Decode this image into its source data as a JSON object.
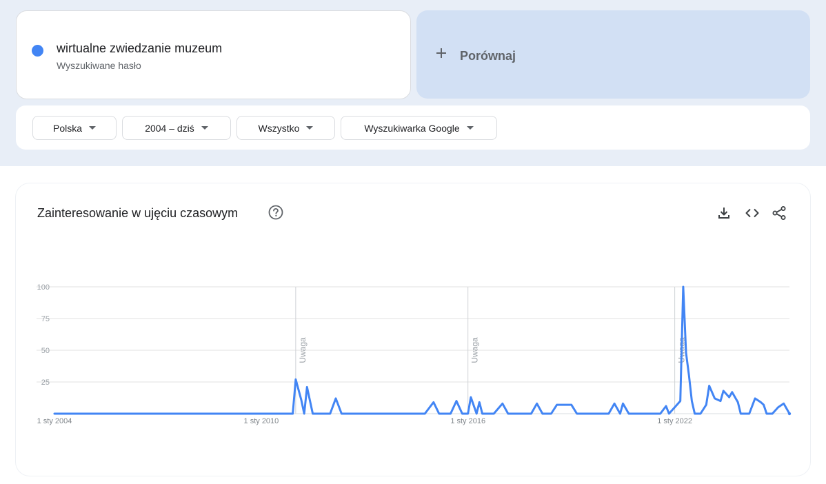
{
  "search_term": {
    "title": "wirtualne zwiedzanie muzeum",
    "subtitle": "Wyszukiwane hasło",
    "color": "#4285f4"
  },
  "compare": {
    "label": "Porównaj",
    "icon": "plus-icon"
  },
  "filters": {
    "region": "Polska",
    "period": "2004 – dziś",
    "category": "Wszystko",
    "source": "Wyszukiwarka Google"
  },
  "panel": {
    "title": "Zainteresowanie w ujęciu czasowym",
    "icons": [
      "help-icon",
      "download-icon",
      "embed-icon",
      "share-icon"
    ]
  },
  "chart_data": {
    "type": "line",
    "ylim": [
      0,
      100
    ],
    "y_ticks": [
      "100",
      "75",
      "50",
      "25"
    ],
    "x_range": [
      "2004-01-01",
      "2025-05-01"
    ],
    "x_ticks": [
      {
        "date": "2004-01-01",
        "label": "1 sty 2004"
      },
      {
        "date": "2010-01-01",
        "label": "1 sty 2010"
      },
      {
        "date": "2016-01-01",
        "label": "1 sty 2016"
      },
      {
        "date": "2022-01-01",
        "label": "1 sty 2022"
      }
    ],
    "notes": [
      {
        "date": "2011-01-01",
        "label": "Uwaga"
      },
      {
        "date": "2016-01-01",
        "label": "Uwaga"
      },
      {
        "date": "2022-01-01",
        "label": "Uwaga"
      }
    ],
    "series": [
      {
        "color": "#4285f4",
        "points": [
          [
            "2004-01-01",
            0
          ],
          [
            "2010-12-01",
            0
          ],
          [
            "2011-01-01",
            27
          ],
          [
            "2011-03-01",
            11
          ],
          [
            "2011-04-01",
            0
          ],
          [
            "2011-05-01",
            21
          ],
          [
            "2011-07-01",
            0
          ],
          [
            "2012-01-01",
            0
          ],
          [
            "2012-03-01",
            12
          ],
          [
            "2012-05-01",
            0
          ],
          [
            "2014-10-01",
            0
          ],
          [
            "2015-01-01",
            9
          ],
          [
            "2015-03-01",
            0
          ],
          [
            "2015-07-01",
            0
          ],
          [
            "2015-09-01",
            10
          ],
          [
            "2015-11-01",
            0
          ],
          [
            "2016-01-01",
            0
          ],
          [
            "2016-02-01",
            13
          ],
          [
            "2016-04-01",
            0
          ],
          [
            "2016-05-01",
            9
          ],
          [
            "2016-06-01",
            0
          ],
          [
            "2016-10-01",
            0
          ],
          [
            "2017-01-01",
            8
          ],
          [
            "2017-03-01",
            0
          ],
          [
            "2017-11-01",
            0
          ],
          [
            "2018-01-01",
            8
          ],
          [
            "2018-03-01",
            0
          ],
          [
            "2018-06-01",
            0
          ],
          [
            "2018-08-01",
            7
          ],
          [
            "2019-01-01",
            7
          ],
          [
            "2019-03-01",
            0
          ],
          [
            "2020-02-01",
            0
          ],
          [
            "2020-04-01",
            8
          ],
          [
            "2020-06-01",
            0
          ],
          [
            "2020-07-01",
            8
          ],
          [
            "2020-09-01",
            0
          ],
          [
            "2021-08-01",
            0
          ],
          [
            "2021-10-01",
            6
          ],
          [
            "2021-11-01",
            0
          ],
          [
            "2022-01-01",
            5
          ],
          [
            "2022-03-01",
            10
          ],
          [
            "2022-04-01",
            100
          ],
          [
            "2022-05-01",
            48
          ],
          [
            "2022-06-01",
            30
          ],
          [
            "2022-07-01",
            10
          ],
          [
            "2022-08-01",
            0
          ],
          [
            "2022-10-01",
            0
          ],
          [
            "2022-12-01",
            7
          ],
          [
            "2023-01-01",
            22
          ],
          [
            "2023-03-01",
            12
          ],
          [
            "2023-05-01",
            10
          ],
          [
            "2023-06-01",
            18
          ],
          [
            "2023-08-01",
            13
          ],
          [
            "2023-09-01",
            17
          ],
          [
            "2023-11-01",
            9
          ],
          [
            "2023-12-01",
            0
          ],
          [
            "2024-03-01",
            0
          ],
          [
            "2024-05-01",
            12
          ],
          [
            "2024-07-01",
            9
          ],
          [
            "2024-08-01",
            7
          ],
          [
            "2024-09-01",
            0
          ],
          [
            "2024-11-01",
            0
          ],
          [
            "2025-01-01",
            5
          ],
          [
            "2025-03-01",
            8
          ],
          [
            "2025-05-01",
            0
          ]
        ]
      }
    ]
  }
}
